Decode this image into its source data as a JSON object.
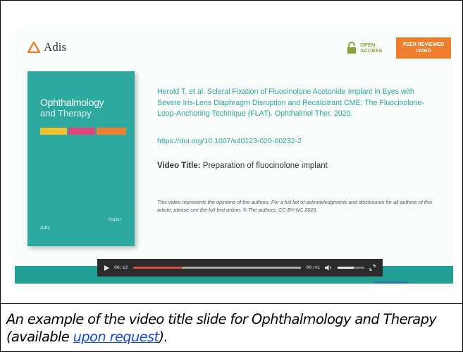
{
  "slide": {
    "logo_text": "Adis",
    "open_access_label": "OPEN ACCESS",
    "peer_badge_label": "PEER REVIEWED VIDEO",
    "cover": {
      "journal_title": "Ophthalmology",
      "journal_subtitle": "and Therapy",
      "publisher": "Adis",
      "imprint": "Rapid+"
    },
    "citation": "Herold T, et al. Scleral Fixation of Fluocinolone Acetonide Implant in Eyes with Severe Iris-Lens Diaphragm Disruption and Recalcitrant CME: The Fluocinolone-Loop-Anchoring Technique (FLAT). Ophthalmol Ther. 2020.",
    "doi": "https://doi.org/10.1007/s40123-020-00232-2",
    "video_title_label": "Video Title:",
    "video_title_value": "Preparation of fluocinolone implant",
    "disclaimer": "This video represents the opinions of the authors. For a full list of acknowledgments and disclosures for all authors of this article, please see the full text online. © The authors, CC-BY-NC 2020."
  },
  "player": {
    "current_time": "00:12",
    "total_time": "00:41",
    "progress_fraction": 0.29,
    "volume_fraction": 0.6
  },
  "caption": {
    "text_before": "An example of the video title slide for Ophthalmology and Therapy (available ",
    "link_text": "upon request",
    "text_after": ")."
  },
  "colors": {
    "teal_brand": "#2da9a0",
    "orange_badge": "#ef7f2c",
    "open_access_green": "#8aa43a",
    "link_blue": "#1a4bd8",
    "progress_red": "#e1483d"
  },
  "icons": [
    "adis-triangle-icon",
    "lock-icon",
    "play-icon",
    "volume-icon",
    "fullscreen-icon"
  ]
}
